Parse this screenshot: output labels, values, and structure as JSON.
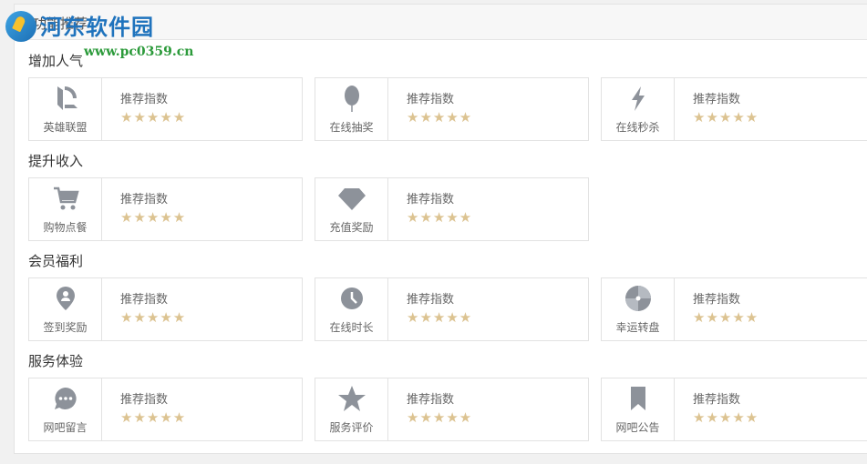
{
  "panel": {
    "title": "功能推荐"
  },
  "watermark": {
    "name": "河东软件园",
    "url": "www.pc0359.cn"
  },
  "sections": [
    {
      "title": "增加人气",
      "items": [
        {
          "name": "英雄联盟",
          "icon": "league-icon",
          "rec_label": "推荐指数",
          "rating": 5,
          "stars": "★★★★★"
        },
        {
          "name": "在线抽奖",
          "icon": "balloon-icon",
          "rec_label": "推荐指数",
          "rating": 5,
          "stars": "★★★★★"
        },
        {
          "name": "在线秒杀",
          "icon": "lightning-icon",
          "rec_label": "推荐指数",
          "rating": 5,
          "stars": "★★★★★"
        }
      ]
    },
    {
      "title": "提升收入",
      "items": [
        {
          "name": "购物点餐",
          "icon": "cart-icon",
          "rec_label": "推荐指数",
          "rating": 5,
          "stars": "★★★★★"
        },
        {
          "name": "充值奖励",
          "icon": "diamond-icon",
          "rec_label": "推荐指数",
          "rating": 5,
          "stars": "★★★★★"
        }
      ]
    },
    {
      "title": "会员福利",
      "items": [
        {
          "name": "签到奖励",
          "icon": "location-pin-icon",
          "rec_label": "推荐指数",
          "rating": 5,
          "stars": "★★★★★"
        },
        {
          "name": "在线时长",
          "icon": "clock-icon",
          "rec_label": "推荐指数",
          "rating": 5,
          "stars": "★★★★★"
        },
        {
          "name": "幸运转盘",
          "icon": "wheel-icon",
          "rec_label": "推荐指数",
          "rating": 5,
          "stars": "★★★★★"
        }
      ]
    },
    {
      "title": "服务体验",
      "items": [
        {
          "name": "网吧留言",
          "icon": "chat-bubble-icon",
          "rec_label": "推荐指数",
          "rating": 5,
          "stars": "★★★★★"
        },
        {
          "name": "服务评价",
          "icon": "star-icon",
          "rec_label": "推荐指数",
          "rating": 5,
          "stars": "★★★★★"
        },
        {
          "name": "网吧公告",
          "icon": "bookmark-icon",
          "rec_label": "推荐指数",
          "rating": 5,
          "stars": "★★★★★"
        }
      ]
    }
  ],
  "colors": {
    "icon": "#8d929a",
    "star": "#dcc391",
    "border": "#e2e2e2"
  }
}
